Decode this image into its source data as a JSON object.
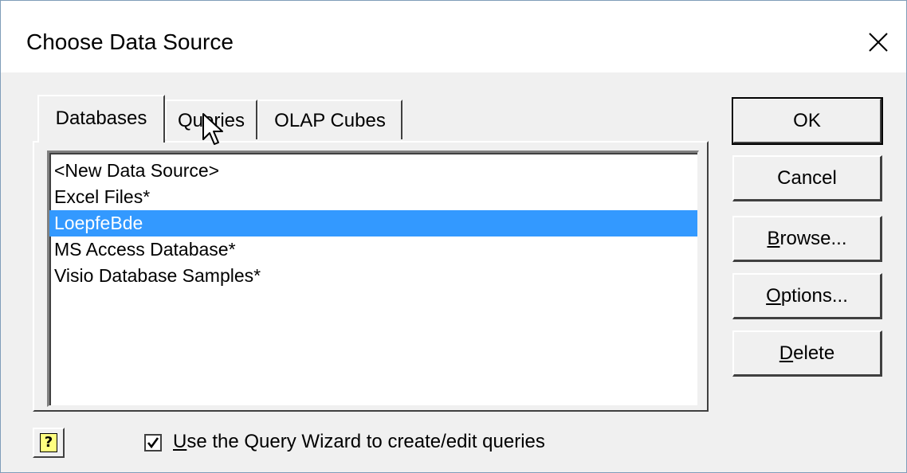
{
  "dialog": {
    "title": "Choose Data Source"
  },
  "tabs": [
    {
      "label": "Databases",
      "active": true
    },
    {
      "label": "Queries",
      "active": false
    },
    {
      "label": "OLAP Cubes",
      "active": false
    }
  ],
  "data_sources": [
    {
      "label": "<New Data Source>",
      "selected": false
    },
    {
      "label": "Excel Files*",
      "selected": false
    },
    {
      "label": "LoepfeBde",
      "selected": true
    },
    {
      "label": "MS Access Database*",
      "selected": false
    },
    {
      "label": "Visio Database Samples*",
      "selected": false
    }
  ],
  "buttons": {
    "ok": "OK",
    "cancel": "Cancel",
    "browse": {
      "accel": "B",
      "rest": "rowse..."
    },
    "options": {
      "accel": "O",
      "rest": "ptions..."
    },
    "delete": {
      "accel": "D",
      "rest": "elete"
    }
  },
  "help_button": {
    "glyph": "?"
  },
  "query_wizard": {
    "checked": true,
    "accel": "U",
    "rest": "se the Query Wizard to create/edit queries"
  },
  "colors": {
    "selection": "#3399ff",
    "dialog_bg": "#f0f0f0"
  }
}
